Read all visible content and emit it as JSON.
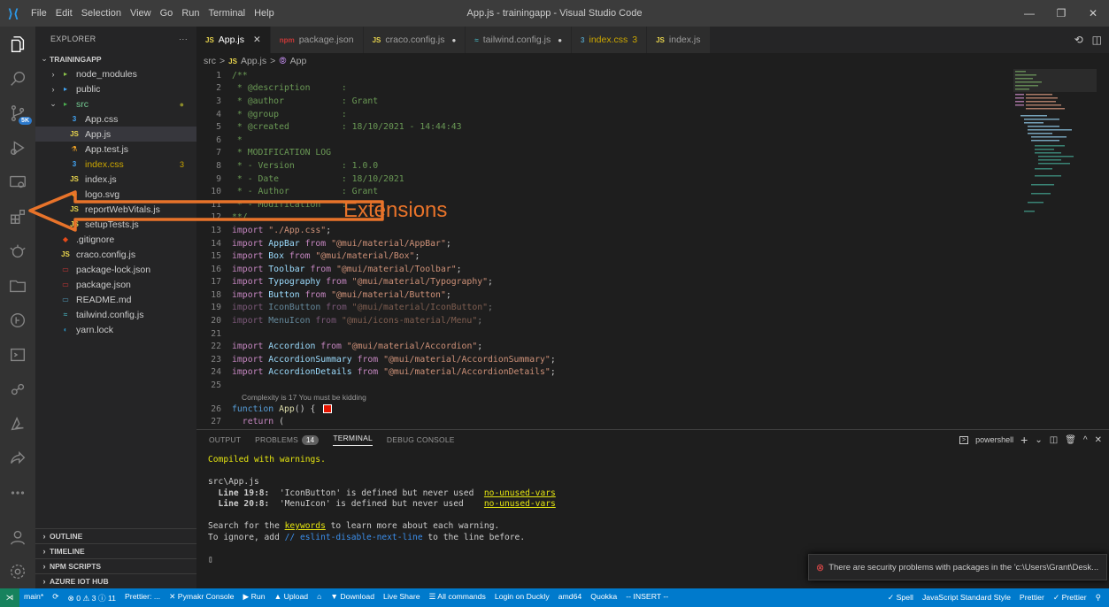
{
  "window": {
    "title": "App.js - trainingapp - Visual Studio Code",
    "menu": [
      "File",
      "Edit",
      "Selection",
      "View",
      "Go",
      "Run",
      "Terminal",
      "Help"
    ]
  },
  "activity": {
    "source_control_badge": "5K"
  },
  "explorer": {
    "header": "EXPLORER",
    "more": "···",
    "root": "TRAININGAPP",
    "items": [
      {
        "label": "node_modules",
        "indent": 1,
        "twist": "›",
        "icon": "folder-node",
        "color": "#cccccc"
      },
      {
        "label": "public",
        "indent": 1,
        "twist": "›",
        "icon": "folder-public",
        "color": "#cccccc"
      },
      {
        "label": "src",
        "indent": 1,
        "twist": "⌄",
        "icon": "folder-src",
        "color": "#73c991",
        "right": "●",
        "right_color": "#8b8b2a"
      },
      {
        "label": "App.css",
        "indent": 2,
        "icon": "css",
        "color": "#cccccc"
      },
      {
        "label": "App.js",
        "indent": 2,
        "icon": "js",
        "color": "#cccccc",
        "selected": true
      },
      {
        "label": "App.test.js",
        "indent": 2,
        "icon": "test",
        "color": "#cccccc"
      },
      {
        "label": "index.css",
        "indent": 2,
        "icon": "css",
        "color": "#cca700",
        "right": "3",
        "right_color": "#cca700"
      },
      {
        "label": "index.js",
        "indent": 2,
        "icon": "js",
        "color": "#cccccc"
      },
      {
        "label": "logo.svg",
        "indent": 2,
        "icon": "svg",
        "color": "#cccccc"
      },
      {
        "label": "reportWebVitals.js",
        "indent": 2,
        "icon": "js",
        "color": "#cccccc"
      },
      {
        "label": "setupTests.js",
        "indent": 2,
        "icon": "js",
        "color": "#cccccc"
      },
      {
        "label": ".gitignore",
        "indent": 1,
        "icon": "git",
        "color": "#cccccc"
      },
      {
        "label": "craco.config.js",
        "indent": 1,
        "icon": "js",
        "color": "#cccccc"
      },
      {
        "label": "package-lock.json",
        "indent": 1,
        "icon": "npm",
        "color": "#cccccc"
      },
      {
        "label": "package.json",
        "indent": 1,
        "icon": "npm",
        "color": "#cccccc"
      },
      {
        "label": "README.md",
        "indent": 1,
        "icon": "md",
        "color": "#cccccc"
      },
      {
        "label": "tailwind.config.js",
        "indent": 1,
        "icon": "tailwind",
        "color": "#cccccc"
      },
      {
        "label": "yarn.lock",
        "indent": 1,
        "icon": "yarn",
        "color": "#cccccc"
      }
    ],
    "sections": [
      "OUTLINE",
      "TIMELINE",
      "NPM SCRIPTS",
      "AZURE IOT HUB"
    ]
  },
  "tabs": [
    {
      "label": "App.js",
      "icon": "JS",
      "icon_color": "#e8d44d",
      "color": "#ffffff",
      "active": true,
      "suffix": "✕"
    },
    {
      "label": "package.json",
      "icon": "npm",
      "icon_color": "#cb3837",
      "color": "#9d9d9d"
    },
    {
      "label": "craco.config.js",
      "icon": "JS",
      "icon_color": "#e8d44d",
      "color": "#9d9d9d",
      "suffix": "●"
    },
    {
      "label": "tailwind.config.js",
      "icon": "≈",
      "icon_color": "#44a8b3",
      "color": "#9d9d9d",
      "suffix": "●"
    },
    {
      "label": "index.css",
      "icon": "3",
      "icon_color": "#519aba",
      "color": "#cca700",
      "num": "3"
    },
    {
      "label": "index.js",
      "icon": "JS",
      "icon_color": "#e8d44d",
      "color": "#9d9d9d"
    }
  ],
  "breadcrumb": {
    "folder": "src",
    "sep": ">",
    "js": "JS",
    "file": "App.js",
    "symbol": "App"
  },
  "code": [
    {
      "n": "1",
      "parts": [
        [
          "c-com",
          "/**"
        ]
      ]
    },
    {
      "n": "2",
      "parts": [
        [
          "c-com",
          " * @description      :"
        ]
      ]
    },
    {
      "n": "3",
      "parts": [
        [
          "c-com",
          " * @author           : Grant"
        ]
      ]
    },
    {
      "n": "4",
      "parts": [
        [
          "c-com",
          " * @group            :"
        ]
      ]
    },
    {
      "n": "5",
      "parts": [
        [
          "c-com",
          " * @created          : 18/10/2021 - 14:44:43"
        ]
      ]
    },
    {
      "n": "6",
      "parts": [
        [
          "c-com",
          " *"
        ]
      ]
    },
    {
      "n": "7",
      "parts": [
        [
          "c-com",
          " * MODIFICATION LOG"
        ]
      ]
    },
    {
      "n": "8",
      "parts": [
        [
          "c-com",
          " * - Version         : 1.0.0"
        ]
      ]
    },
    {
      "n": "9",
      "parts": [
        [
          "c-com",
          " * - Date            : 18/10/2021"
        ]
      ]
    },
    {
      "n": "10",
      "parts": [
        [
          "c-com",
          " * - Author          : Grant"
        ]
      ]
    },
    {
      "n": "11",
      "parts": [
        [
          "c-com",
          " * - Modification    :"
        ]
      ]
    },
    {
      "n": "12",
      "parts": [
        [
          "c-com",
          "**/"
        ]
      ]
    },
    {
      "n": "13",
      "parts": [
        [
          "c-kw",
          "import"
        ],
        [
          "",
          " "
        ],
        [
          "c-str",
          "\"./App.css\""
        ],
        [
          "",
          ";"
        ]
      ]
    },
    {
      "n": "14",
      "parts": [
        [
          "c-kw",
          "import"
        ],
        [
          "c-id",
          " AppBar "
        ],
        [
          "c-kw",
          "from"
        ],
        [
          "",
          " "
        ],
        [
          "c-str",
          "\"@mui/material/AppBar\""
        ],
        [
          "",
          ";"
        ]
      ]
    },
    {
      "n": "15",
      "parts": [
        [
          "c-kw",
          "import"
        ],
        [
          "c-id",
          " Box "
        ],
        [
          "c-kw",
          "from"
        ],
        [
          "",
          " "
        ],
        [
          "c-str",
          "\"@mui/material/Box\""
        ],
        [
          "",
          ";"
        ]
      ]
    },
    {
      "n": "16",
      "parts": [
        [
          "c-kw",
          "import"
        ],
        [
          "c-id",
          " Toolbar "
        ],
        [
          "c-kw",
          "from"
        ],
        [
          "",
          " "
        ],
        [
          "c-str",
          "\"@mui/material/Toolbar\""
        ],
        [
          "",
          ";"
        ]
      ]
    },
    {
      "n": "17",
      "parts": [
        [
          "c-kw",
          "import"
        ],
        [
          "c-id",
          " Typography "
        ],
        [
          "c-kw",
          "from"
        ],
        [
          "",
          " "
        ],
        [
          "c-str",
          "\"@mui/material/Typography\""
        ],
        [
          "",
          ";"
        ]
      ]
    },
    {
      "n": "18",
      "parts": [
        [
          "c-kw",
          "import"
        ],
        [
          "c-id",
          " Button "
        ],
        [
          "c-kw",
          "from"
        ],
        [
          "",
          " "
        ],
        [
          "c-str",
          "\"@mui/material/Button\""
        ],
        [
          "",
          ";"
        ]
      ]
    },
    {
      "n": "19",
      "parts": [
        [
          "c-kw c-dim",
          "import"
        ],
        [
          "c-id c-dim",
          " IconButton "
        ],
        [
          "c-kw c-dim",
          "from"
        ],
        [
          "",
          " "
        ],
        [
          "c-str c-dim",
          "\"@mui/material/IconButton\""
        ],
        [
          "c-dim",
          ";"
        ]
      ]
    },
    {
      "n": "20",
      "parts": [
        [
          "c-kw c-dim",
          "import"
        ],
        [
          "c-id c-dim",
          " MenuIcon "
        ],
        [
          "c-kw c-dim",
          "from"
        ],
        [
          "",
          " "
        ],
        [
          "c-str c-dim",
          "\"@mui/icons-material/Menu\""
        ],
        [
          "c-dim",
          ";"
        ]
      ]
    },
    {
      "n": "21",
      "parts": []
    },
    {
      "n": "22",
      "parts": [
        [
          "c-kw",
          "import"
        ],
        [
          "c-id",
          " Accordion "
        ],
        [
          "c-kw",
          "from"
        ],
        [
          "",
          " "
        ],
        [
          "c-str",
          "\"@mui/material/Accordion\""
        ],
        [
          "",
          ";"
        ]
      ]
    },
    {
      "n": "23",
      "parts": [
        [
          "c-kw",
          "import"
        ],
        [
          "c-id",
          " AccordionSummary "
        ],
        [
          "c-kw",
          "from"
        ],
        [
          "",
          " "
        ],
        [
          "c-str",
          "\"@mui/material/AccordionSummary\""
        ],
        [
          "",
          ";"
        ]
      ]
    },
    {
      "n": "24",
      "parts": [
        [
          "c-kw",
          "import"
        ],
        [
          "c-id",
          " AccordionDetails "
        ],
        [
          "c-kw",
          "from"
        ],
        [
          "",
          " "
        ],
        [
          "c-str",
          "\"@mui/material/AccordionDetails\""
        ],
        [
          "",
          ";"
        ]
      ]
    },
    {
      "n": "25",
      "parts": []
    },
    {
      "lens": "Complexity is 17 You must be kidding"
    },
    {
      "n": "26",
      "parts": [
        [
          "c-dk",
          "function"
        ],
        [
          "",
          " "
        ],
        [
          "c-fn",
          "App"
        ],
        [
          "",
          "() { "
        ]
      ],
      "redbox": true
    },
    {
      "n": "27",
      "parts": [
        [
          "c-kw",
          "  return"
        ],
        [
          "",
          " ("
        ]
      ]
    }
  ],
  "annotation": {
    "label": "Extensions"
  },
  "panel": {
    "tabs": [
      "OUTPUT",
      "PROBLEMS",
      "TERMINAL",
      "DEBUG CONSOLE"
    ],
    "problems_count": "14",
    "shell": "powershell",
    "terminal": {
      "compiled": "Compiled with warnings.",
      "file": "src\\App.js",
      "w1_loc": "  Line 19:8:",
      "w1_msg": "  'IconButton' is defined but never used  ",
      "w1_rule": "no-unused-vars",
      "w2_loc": "  Line 20:8:",
      "w2_msg": "  'MenuIcon' is defined but never used    ",
      "w2_rule": "no-unused-vars",
      "search_pre": "Search for the ",
      "search_kw": "keywords",
      "search_post": " to learn more about each warning.",
      "ignore_pre": "To ignore, add ",
      "ignore_code": "// eslint-disable-next-line",
      "ignore_post": " to the line before.",
      "cursor": "▯"
    }
  },
  "toast": {
    "message": "There are security problems with packages in the 'c:\\Users\\Grant\\Desk..."
  },
  "statusbar": {
    "left": [
      "main*",
      "⟳",
      "⊗ 0 ⚠ 3 ⓘ 11",
      "Prettier: ...",
      "✕ Pymakr Console",
      "▶ Run",
      "▲ Upload",
      "⌂",
      "▼ Download",
      "Live Share",
      "☰ All commands",
      "Login on Duckly",
      "amd64",
      "Quokka",
      "-- INSERT --"
    ],
    "right": [
      "✓ Spell",
      "JavaScript Standard Style",
      "Prettier",
      "✓ Prettier",
      "⚲"
    ]
  }
}
